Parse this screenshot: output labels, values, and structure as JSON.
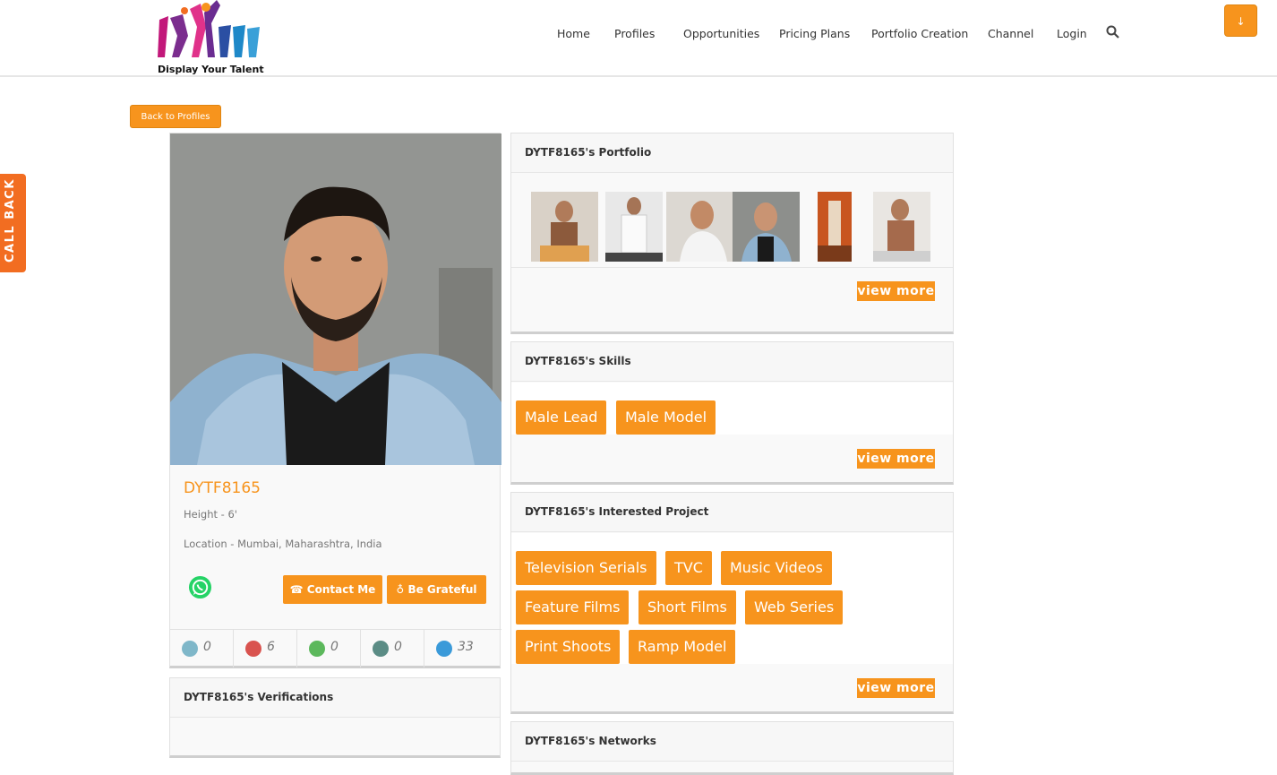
{
  "header": {
    "logo_text": "Display Your Talent",
    "nav": [
      {
        "label": "Home"
      },
      {
        "label": "Profiles"
      },
      {
        "label": "Opportunities"
      },
      {
        "label": "Pricing Plans"
      },
      {
        "label": "Portfolio Creation"
      },
      {
        "label": "Channel"
      },
      {
        "label": "Login"
      }
    ],
    "scroll_btn": "↓"
  },
  "callback": {
    "label": "CALL BACK"
  },
  "back_btn": "Back to Profiles",
  "profile": {
    "name": "DYTF8165",
    "height": "Height - 6'",
    "location": "Location - Mumbai, Maharashtra, India",
    "contact_label": "Contact Me",
    "grateful_label": "Be Grateful",
    "stats": [
      {
        "icon": "video-icon",
        "value": "0",
        "color": "#7fb7c9"
      },
      {
        "icon": "photo-gallery-icon",
        "value": "6",
        "color": "#d9534f"
      },
      {
        "icon": "music-icon",
        "value": "0",
        "color": "#5cb85c"
      },
      {
        "icon": "monitor-icon",
        "value": "0",
        "color": "#5b8c85"
      },
      {
        "icon": "views-icon",
        "value": "33",
        "color": "#3a9ad9"
      }
    ]
  },
  "verifications": {
    "title": "DYTF8165's Verifications"
  },
  "portfolio": {
    "title": "DYTF8165's Portfolio",
    "view_more": "view more"
  },
  "skills": {
    "title": "DYTF8165's Skills",
    "tags": [
      "Male Lead",
      "Male Model"
    ],
    "view_more": "view more"
  },
  "interested": {
    "title": "DYTF8165's Interested Project",
    "tags": [
      "Television Serials",
      "TVC",
      "Music Videos",
      "Feature Films",
      "Short Films",
      "Web Series",
      "Print Shoots",
      "Ramp Model"
    ],
    "view_more": "view more"
  },
  "networks": {
    "title": "DYTF8165's Networks"
  },
  "colors": {
    "accent": "#f7941d",
    "callback": "#f26d21",
    "whatsapp": "#25d366"
  }
}
